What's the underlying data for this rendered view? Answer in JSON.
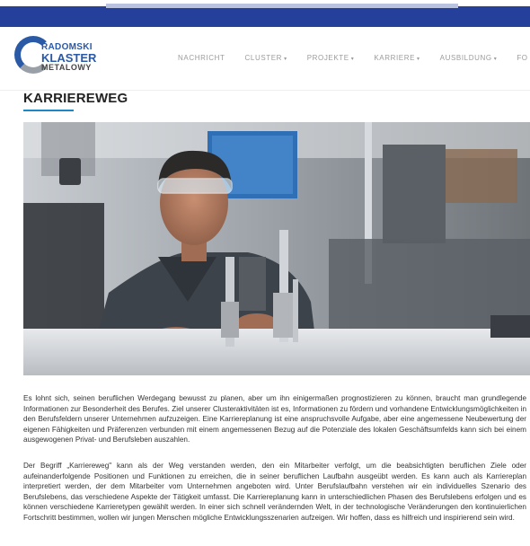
{
  "brand": {
    "logo_line1": "RADOMSKI",
    "logo_line2": "KLASTER",
    "logo_line3": "METALOWY",
    "colors": {
      "primary": "#24409a",
      "accent": "#1e88c7"
    }
  },
  "nav": {
    "items": [
      {
        "label": "NACHRICHT",
        "dropdown": false
      },
      {
        "label": "CLUSTER",
        "dropdown": true
      },
      {
        "label": "PROJEKTE",
        "dropdown": true
      },
      {
        "label": "KARRIERE",
        "dropdown": true
      },
      {
        "label": "AUSBILDUNG",
        "dropdown": true
      },
      {
        "label": "FO",
        "dropdown": false
      }
    ],
    "caret": "▾"
  },
  "page": {
    "title": "KARRIEREWEG"
  },
  "content": {
    "paragraph1": "Es lohnt sich, seinen beruflichen Werdegang bewusst zu planen, aber um ihn einigermaßen prognostizieren zu können, braucht man grundlegende Informationen zur Besonderheit des Berufes. Ziel unserer Clusteraktivitäten ist es, Informationen zu fördern und vorhandene Entwicklungsmöglichkeiten in den Berufsfeldern unserer Unternehmen aufzuzeigen. Eine Karriereplanung ist eine anspruchsvolle Aufgabe, aber eine angemessene Neubewertung der eigenen Fähigkeiten und Präferenzen verbunden mit einem angemessenen Bezug auf die Potenziale des lokalen Geschäftsumfelds kann sich bei einem ausgewogenen Privat- und Berufsleben auszahlen.",
    "paragraph2": "Der Begriff „Karriereweg\" kann als der Weg verstanden werden, den ein Mitarbeiter verfolgt, um die beabsichtigten beruflichen Ziele oder aufeinanderfolgende Positionen und Funktionen zu erreichen, die in seiner beruflichen Laufbahn ausgeübt werden. Es kann auch als Karriereplan interpretiert werden, der dem Mitarbeiter vom Unternehmen angeboten wird. Unter Berufslaufbahn verstehen wir ein individuelles Szenario des Berufslebens, das verschiedene Aspekte der Tätigkeit umfasst. Die Karriereplanung kann in unterschiedlichen Phasen des Berufslebens erfolgen und es können verschiedene Karrieretypen gewählt werden. In einer sich schnell verändernden Welt, in der technologische Veränderungen den kontinuierlichen Fortschritt bestimmen, wollen wir jungen Menschen mögliche Entwicklungsszenarien aufzeigen. Wir hoffen, dass es hilfreich und inspirierend sein wird."
  },
  "hero": {
    "icon": "worker-lab-photo"
  }
}
